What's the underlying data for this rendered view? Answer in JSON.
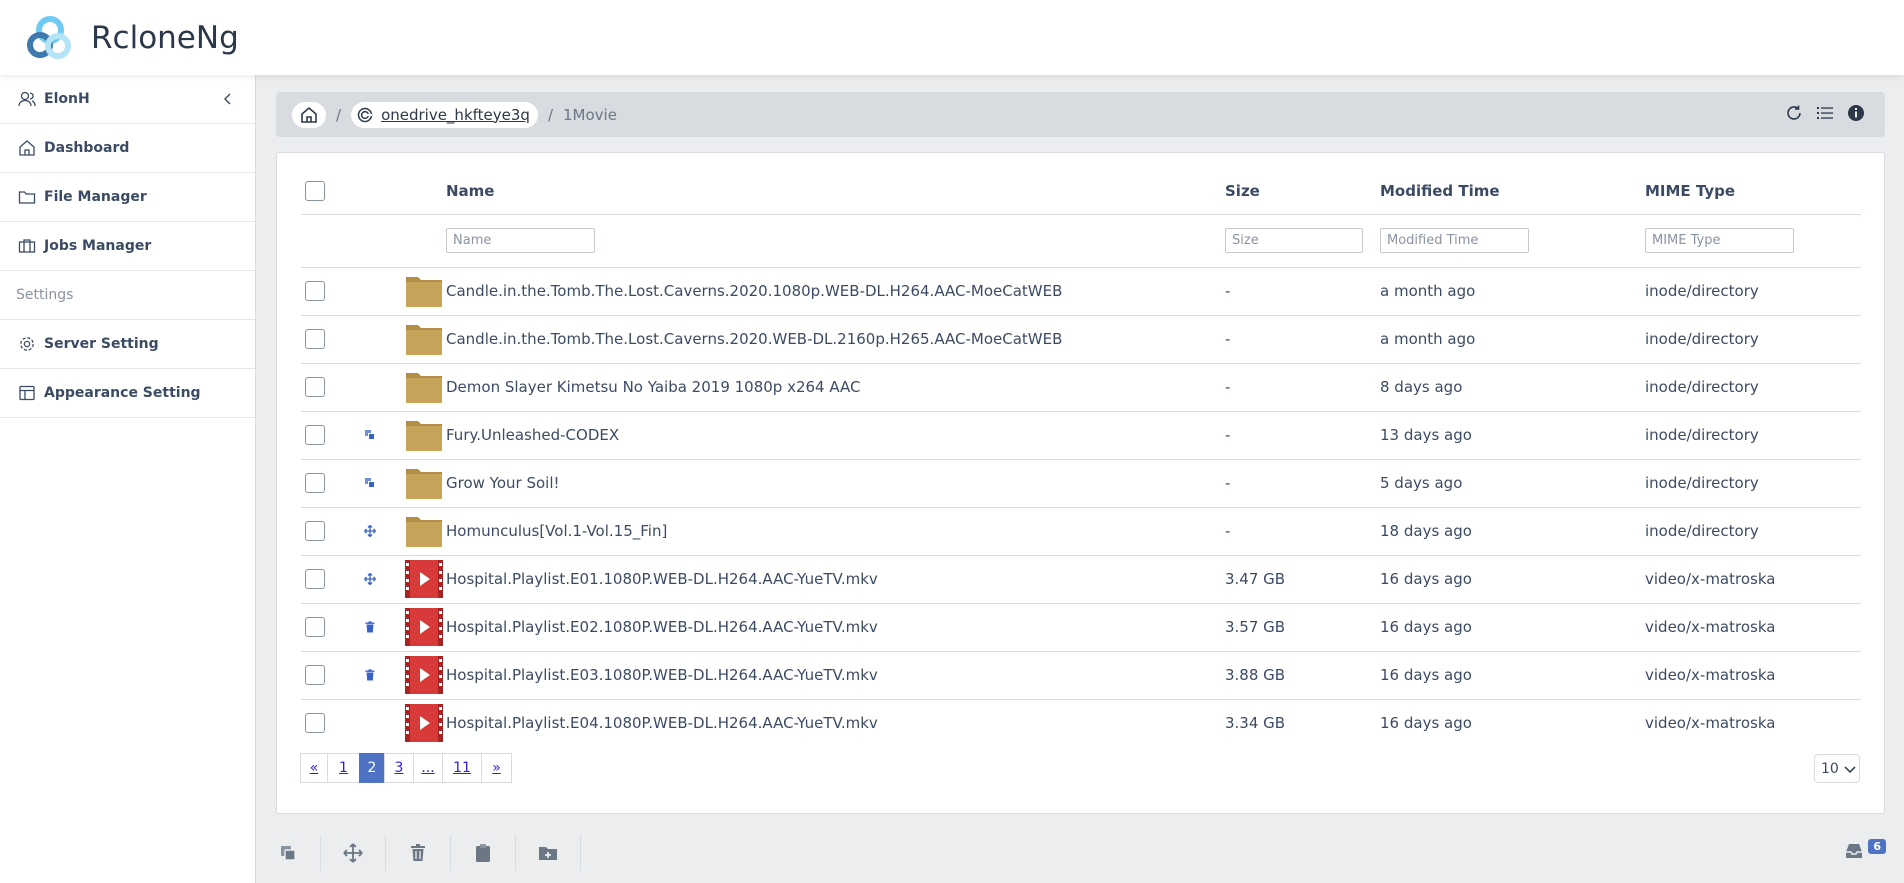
{
  "app": {
    "title": "RcloneNg"
  },
  "sidebar": {
    "user": "ElonH",
    "items": [
      {
        "label": "Dashboard",
        "icon": "home-icon"
      },
      {
        "label": "File Manager",
        "icon": "folder-icon"
      },
      {
        "label": "Jobs Manager",
        "icon": "briefcase-icon"
      }
    ],
    "section_title": "Settings",
    "settings": [
      {
        "label": "Server Setting",
        "icon": "gear-icon"
      },
      {
        "label": "Appearance Setting",
        "icon": "layout-icon"
      }
    ]
  },
  "breadcrumb": {
    "sep": "/",
    "remote": "onedrive_hkfteye3q",
    "current": "1Movie"
  },
  "table": {
    "headers": {
      "name": "Name",
      "size": "Size",
      "modified": "Modified Time",
      "mime": "MIME Type"
    },
    "placeholders": {
      "name": "Name",
      "size": "Size",
      "modified": "Modified Time",
      "mime": "MIME Type"
    },
    "rows": [
      {
        "mark": "",
        "type": "folder",
        "name": "Candle.in.the.Tomb.The.Lost.Caverns.2020.1080p.WEB-DL.H264.AAC-MoeCatWEB",
        "size": "-",
        "modified": "a month ago",
        "mime": "inode/directory"
      },
      {
        "mark": "",
        "type": "folder",
        "name": "Candle.in.the.Tomb.The.Lost.Caverns.2020.WEB-DL.2160p.H265.AAC-MoeCatWEB",
        "size": "-",
        "modified": "a month ago",
        "mime": "inode/directory"
      },
      {
        "mark": "",
        "type": "folder",
        "name": "Demon Slayer Kimetsu No Yaiba 2019 1080p x264 AAC",
        "size": "-",
        "modified": "8 days ago",
        "mime": "inode/directory"
      },
      {
        "mark": "copy",
        "type": "folder",
        "name": "Fury.Unleashed-CODEX",
        "size": "-",
        "modified": "13 days ago",
        "mime": "inode/directory"
      },
      {
        "mark": "copy",
        "type": "folder",
        "name": "Grow Your Soil!",
        "size": "-",
        "modified": "5 days ago",
        "mime": "inode/directory"
      },
      {
        "mark": "move",
        "type": "folder",
        "name": "Homunculus[Vol.1-Vol.15_Fin]",
        "size": "-",
        "modified": "18 days ago",
        "mime": "inode/directory"
      },
      {
        "mark": "move",
        "type": "video",
        "name": "Hospital.Playlist.E01.1080P.WEB-DL.H264.AAC-YueTV.mkv",
        "size": "3.47 GB",
        "modified": "16 days ago",
        "mime": "video/x-matroska"
      },
      {
        "mark": "delete",
        "type": "video",
        "name": "Hospital.Playlist.E02.1080P.WEB-DL.H264.AAC-YueTV.mkv",
        "size": "3.57 GB",
        "modified": "16 days ago",
        "mime": "video/x-matroska"
      },
      {
        "mark": "delete",
        "type": "video",
        "name": "Hospital.Playlist.E03.1080P.WEB-DL.H264.AAC-YueTV.mkv",
        "size": "3.88 GB",
        "modified": "16 days ago",
        "mime": "video/x-matroska"
      },
      {
        "mark": "",
        "type": "video",
        "name": "Hospital.Playlist.E04.1080P.WEB-DL.H264.AAC-YueTV.mkv",
        "size": "3.34 GB",
        "modified": "16 days ago",
        "mime": "video/x-matroska"
      }
    ]
  },
  "pagination": {
    "pages": [
      "«",
      "1",
      "2",
      "3",
      "...",
      "11",
      "»"
    ],
    "active": "2",
    "per_page": "10"
  },
  "toolbar": {
    "buttons": [
      "copy-icon",
      "move-icon",
      "delete-icon",
      "paste-icon",
      "new-folder-icon"
    ],
    "jobs_count": "6"
  },
  "colors": {
    "accent": "#4f73c4",
    "folder": "#c8a35a",
    "video": "#d83a3a"
  }
}
